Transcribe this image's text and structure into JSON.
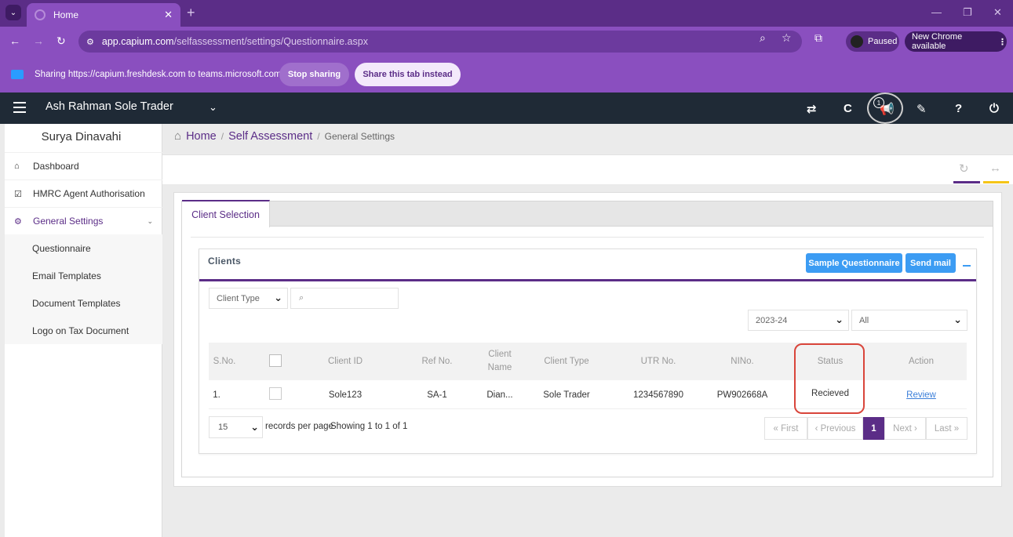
{
  "browser": {
    "tab_title": "Home",
    "tab_close": "✕",
    "new_tab": "+",
    "url_host": "app.capium.com",
    "url_path": "/selfassessment/settings/Questionnaire.aspx",
    "profile_status": "Paused",
    "update_notice": "New Chrome available",
    "win_minimize": "—",
    "win_restore": "❐",
    "win_close": "✕"
  },
  "sharing_bar": {
    "message": "Sharing https://capium.freshdesk.com to teams.microsoft.com",
    "stop_label": "Stop sharing",
    "share_tab_label": "Share this tab instead"
  },
  "header": {
    "company": "Ash Rahman Sole Trader",
    "notification_count": "1"
  },
  "sidebar": {
    "user_name": "Surya Dinavahi",
    "items": [
      {
        "label": "Dashboard"
      },
      {
        "label": "HMRC Agent Authorisation"
      },
      {
        "label": "General Settings"
      }
    ],
    "sub_items": [
      {
        "label": "Questionnaire"
      },
      {
        "label": "Email Templates"
      },
      {
        "label": "Document Templates"
      },
      {
        "label": "Logo on Tax Document"
      }
    ]
  },
  "breadcrumb": {
    "home": "Home",
    "section": "Self Assessment",
    "current": "General Settings",
    "sep": "/"
  },
  "tabs": {
    "active": "Client Selection"
  },
  "clients_card": {
    "title": "Clients",
    "sample_button": "Sample Questionnaire",
    "send_button": "Send mail"
  },
  "filters": {
    "client_type": "Client Type",
    "year": "2023-24",
    "status": "All"
  },
  "table": {
    "headers": {
      "sno": "S.No.",
      "client_id": "Client ID",
      "ref_no": "Ref No.",
      "client_name": "Client Name",
      "client_type": "Client Type",
      "utr": "UTR No.",
      "nino": "NINo.",
      "status": "Status",
      "action": "Action"
    },
    "rows": [
      {
        "sno": "1.",
        "client_id": "Sole123",
        "ref_no": "SA-1",
        "client_name": "Dian...",
        "client_type": "Sole Trader",
        "utr": "1234567890",
        "nino": "PW902668A",
        "status": "Recieved",
        "action": "Review"
      }
    ]
  },
  "pagination": {
    "page_size": "15",
    "records_label": "records per page",
    "showing": "Showing 1 to 1 of 1",
    "first": "« First",
    "previous": "‹ Previous",
    "current": "1",
    "next": "Next ›",
    "last": "Last »"
  },
  "colors": {
    "brand_purple": "#5b2d87",
    "header_dark": "#1f2a36",
    "button_blue": "#3c9cf3",
    "highlight_red": "#d9453b",
    "accent_yellow": "#f5c518"
  }
}
